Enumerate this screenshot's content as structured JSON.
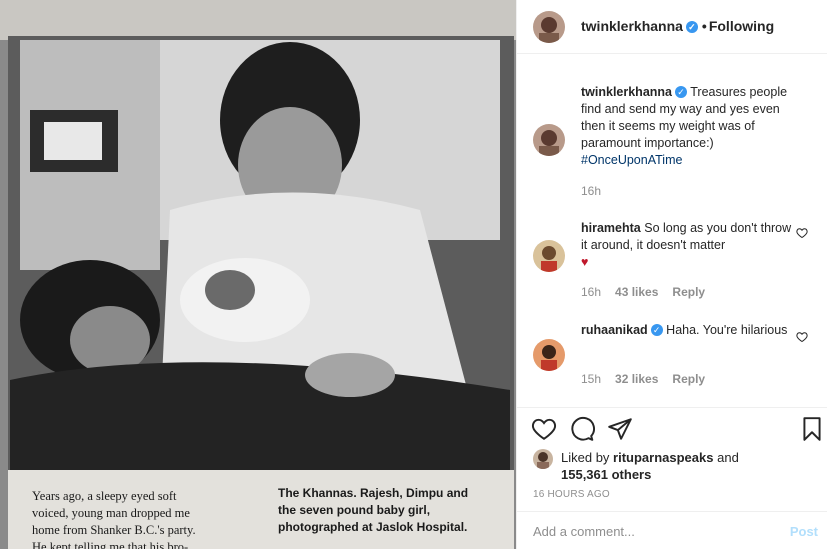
{
  "post": {
    "user": "twinklerkhanna",
    "separator": "•",
    "follow_label": "Following",
    "photo": {
      "caption_left": [
        "Years ago, a sleepy eyed soft",
        "voiced, young man dropped me",
        "home from Shanker B.C.'s party.",
        "He kept telling me that his bro-"
      ],
      "caption_right": [
        "The Khannas. Rajesh, Dimpu and",
        "the seven pound baby girl,",
        "photographed at Jaslok Hospital."
      ]
    }
  },
  "comments": [
    {
      "user": "twinklerkhanna",
      "text": "Treasures people find and send my way and yes even then it seems my weight was of paramount importance:)",
      "hashtag": "#OnceUponATime",
      "time": "16h"
    },
    {
      "user": "hiramehta",
      "text": "So long as you don't throw it around, it doesn't matter",
      "emoji": "♥",
      "time": "16h",
      "likes": "43 likes",
      "reply": "Reply"
    },
    {
      "user": "ruhaanikad",
      "text": "Haha. You're hilarious",
      "time": "15h",
      "likes": "32 likes",
      "reply": "Reply"
    }
  ],
  "actions": {
    "liked_prefix": "Liked by",
    "liked_user": "rituparnaspeaks",
    "liked_and": "and",
    "liked_count": "155,361 others",
    "timestamp": "16 HOURS AGO"
  },
  "add_comment": {
    "placeholder": "Add a comment...",
    "post_label": "Post"
  },
  "icons": [
    "verified-badge-icon",
    "heart-icon",
    "comment-icon",
    "share-icon",
    "bookmark-icon"
  ],
  "colors": {
    "accent": "#3897f0",
    "text": "#262626",
    "muted": "#8e8e8e",
    "post_disabled": "#b2dffc",
    "heart_red": "#ed4956"
  }
}
